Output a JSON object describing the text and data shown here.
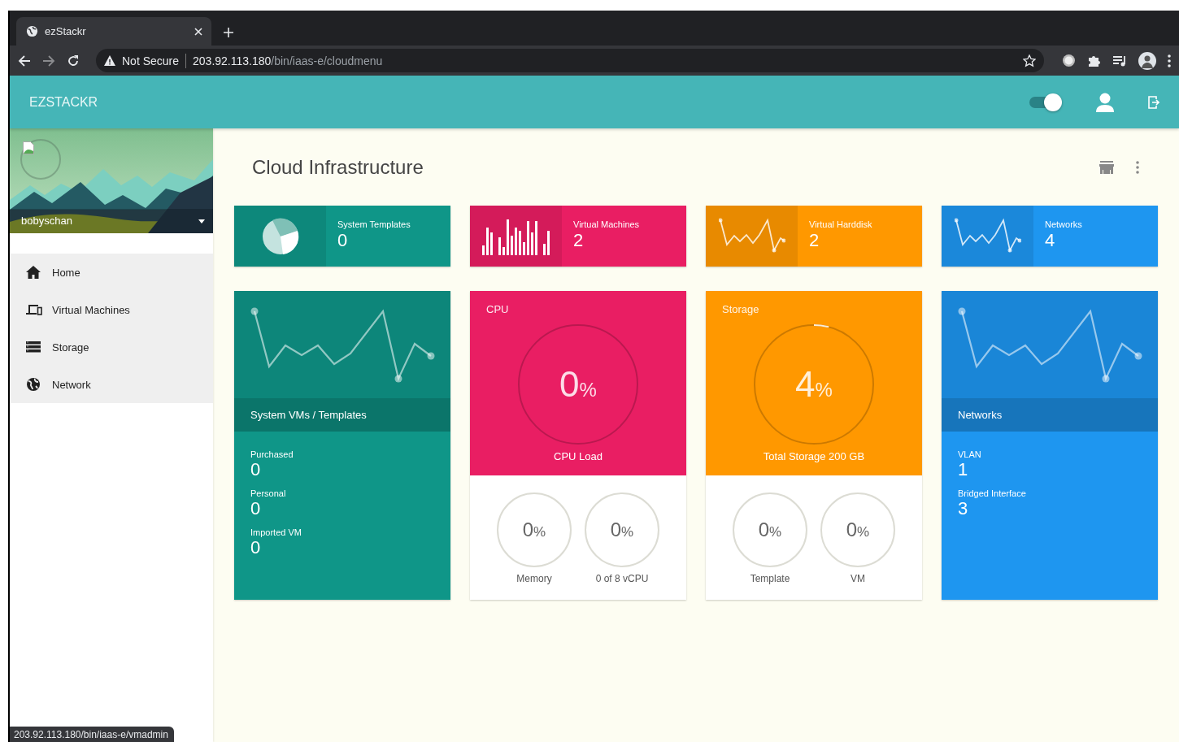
{
  "browser": {
    "tab_title": "ezStackr",
    "url_warning": "Not Secure",
    "url_host": "203.92.113.180",
    "url_path": "/bin/iaas-e/cloudmenu",
    "status_url": "203.92.113.180/bin/iaas-e/vmadmin"
  },
  "header": {
    "brand": "EZSTACKR",
    "toggle": {
      "on": true
    }
  },
  "sidebar": {
    "user": "bobyschan",
    "items": [
      {
        "label": "Home",
        "kind": "home",
        "selected": false
      },
      {
        "label": "Virtual Machines",
        "kind": "devices",
        "selected": false
      },
      {
        "label": "Storage",
        "kind": "storage",
        "selected": false
      },
      {
        "label": "Network",
        "kind": "globe",
        "selected": false
      }
    ]
  },
  "content": {
    "title": "Cloud Infrastructure",
    "summary_cards": [
      {
        "label": "System Templates",
        "value": "0",
        "kind": "pie",
        "color": "#0f9688"
      },
      {
        "label": "Virtual Machines",
        "value": "2",
        "kind": "bars",
        "color": "#e91e63"
      },
      {
        "label": "Virtual Harddisk",
        "value": "2",
        "kind": "line",
        "color": "#ff9800"
      },
      {
        "label": "Networks",
        "value": "4",
        "kind": "line",
        "color": "#1e96f0"
      }
    ],
    "panels": [
      {
        "kind": "stats",
        "color": "#0f9688",
        "caption": "System VMs / Templates",
        "stats": [
          {
            "label": "Purchased",
            "value": "0"
          },
          {
            "label": "Personal",
            "value": "0"
          },
          {
            "label": "Imported VM",
            "value": "0"
          }
        ]
      },
      {
        "kind": "gauge",
        "color": "#e91e63",
        "title": "CPU",
        "value": "0",
        "unit": "%",
        "caption": "CPU Load",
        "sub_gauges": [
          {
            "value": "0",
            "unit": "%",
            "label": "Memory"
          },
          {
            "value": "0",
            "unit": "%",
            "label": "0 of 8 vCPU"
          }
        ]
      },
      {
        "kind": "gauge",
        "color": "#ff9800",
        "title": "Storage",
        "value": "4",
        "unit": "%",
        "caption": "Total Storage 200 GB",
        "sub_gauges": [
          {
            "value": "0",
            "unit": "%",
            "label": "Template"
          },
          {
            "value": "0",
            "unit": "%",
            "label": "VM"
          }
        ]
      },
      {
        "kind": "stats",
        "color": "#1e96f0",
        "caption": "Networks",
        "stats": [
          {
            "label": "VLAN",
            "value": "1"
          },
          {
            "label": "Bridged Interface",
            "value": "3"
          }
        ]
      }
    ]
  }
}
